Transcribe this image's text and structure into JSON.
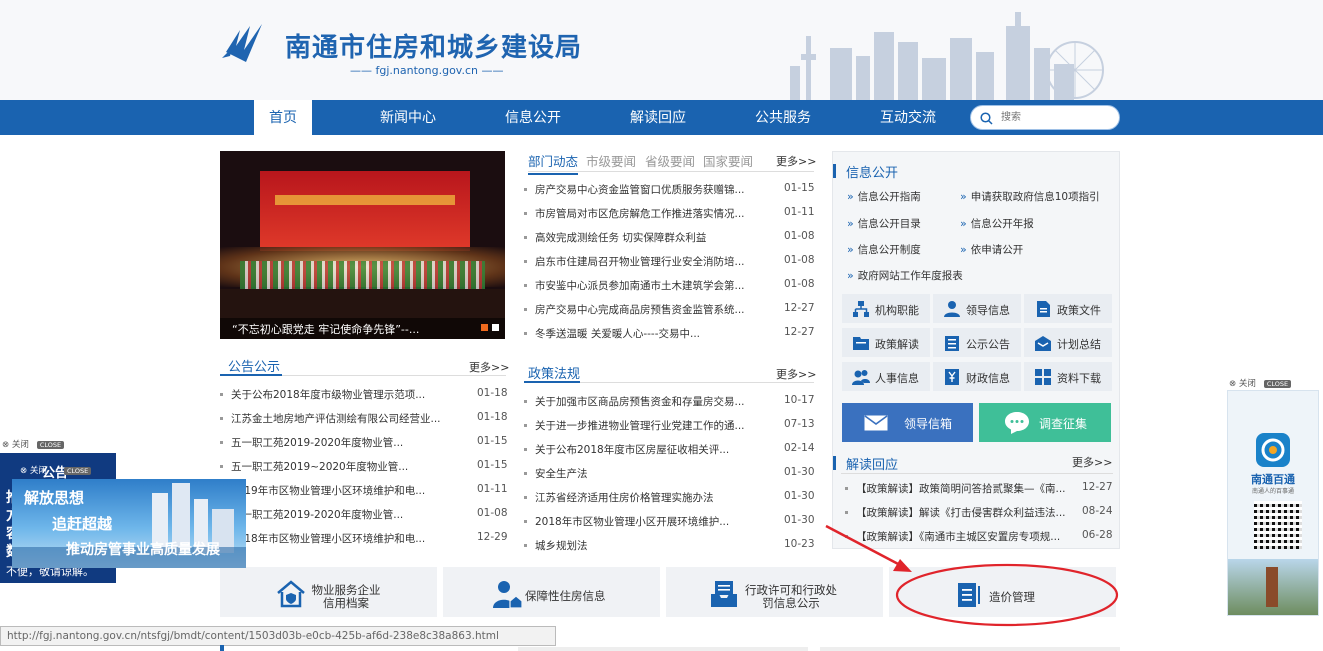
{
  "header": {
    "site_title": "南通市住房和城乡建设局",
    "domain": "—— fgj.nantong.gov.cn ——"
  },
  "nav": {
    "items": [
      "首页",
      "新闻中心",
      "信息公开",
      "解读回应",
      "公共服务",
      "互动交流"
    ],
    "active_index": 0
  },
  "search": {
    "placeholder": "搜索"
  },
  "slideshow": {
    "caption": "“不忘初心跟党走 牢记使命争先锋”--...",
    "dots": [
      {
        "color": "#f06a1e"
      },
      {
        "color": "#ffffff"
      }
    ]
  },
  "news": {
    "tabs": [
      "部门动态",
      "市级要闻",
      "省级要闻",
      "国家要闻"
    ],
    "active_tab": 0,
    "more": "更多>>",
    "items": [
      {
        "title": "房产交易中心资金监管窗口优质服务获赠锦...",
        "date": "01-15"
      },
      {
        "title": "市房管局对市区危房解危工作推进落实情况...",
        "date": "01-11"
      },
      {
        "title": "高效完成测绘任务 切实保障群众利益",
        "date": "01-08"
      },
      {
        "title": "启东市住建局召开物业管理行业安全消防培...",
        "date": "01-08"
      },
      {
        "title": "市安鉴中心派员参加南通市土木建筑学会第...",
        "date": "01-08"
      },
      {
        "title": "房产交易中心完成商品房预售资金监管系统...",
        "date": "12-27"
      },
      {
        "title": "冬季送温暖 关爱暖人心----交易中...",
        "date": "12-27"
      }
    ]
  },
  "notice": {
    "title": "公告公示",
    "more": "更多>>",
    "items": [
      {
        "title": "关于公布2018年度市级物业管理示范项...",
        "date": "01-18"
      },
      {
        "title": "江苏金土地房地产评估测绘有限公司经营业...",
        "date": "01-18"
      },
      {
        "title": "五一职工苑2019-2020年度物业管...",
        "date": "01-15"
      },
      {
        "title": "五一职工苑2019~2020年度物业管...",
        "date": "01-15"
      },
      {
        "title": "2019年市区物业管理小区环境维护和电...",
        "date": "01-11"
      },
      {
        "title": "五一职工苑2019-2020年度物业管...",
        "date": "01-08"
      },
      {
        "title": "2018年市区物业管理小区环境维护和电...",
        "date": "12-29"
      }
    ]
  },
  "policy": {
    "title": "政策法规",
    "more": "更多>>",
    "items": [
      {
        "title": "关于加强市区商品房预售资金和存量房交易...",
        "date": "10-17"
      },
      {
        "title": "关于进一步推进物业管理行业党建工作的通...",
        "date": "07-13"
      },
      {
        "title": "关于公布2018年度市区房屋征收相关评...",
        "date": "02-14"
      },
      {
        "title": "安全生产法",
        "date": "01-30"
      },
      {
        "title": "江苏省经济适用住房价格管理实施办法",
        "date": "01-30"
      },
      {
        "title": "2018年市区物业管理小区开展环境维护...",
        "date": "01-30"
      },
      {
        "title": "城乡规划法",
        "date": "10-23"
      }
    ]
  },
  "info_open": {
    "title": "信息公开",
    "links": [
      "信息公开指南",
      "申请获取政府信息10项指引",
      "信息公开目录",
      "信息公开年报",
      "信息公开制度",
      "依申请公开",
      "政府网站工作年度报表"
    ],
    "tiles": [
      {
        "label": "机构职能",
        "icon": "org-chart-icon"
      },
      {
        "label": "领导信息",
        "icon": "leader-icon"
      },
      {
        "label": "政策文件",
        "icon": "policy-file-icon"
      },
      {
        "label": "政策解读",
        "icon": "policy-interpret-icon"
      },
      {
        "label": "公示公告",
        "icon": "notice-board-icon"
      },
      {
        "label": "计划总结",
        "icon": "plan-summary-icon"
      },
      {
        "label": "人事信息",
        "icon": "personnel-icon"
      },
      {
        "label": "财政信息",
        "icon": "finance-icon"
      },
      {
        "label": "资料下载",
        "icon": "download-grid-icon"
      }
    ],
    "mailbox": {
      "label": "领导信箱",
      "color": "#3a71bf"
    },
    "survey": {
      "label": "调查征集",
      "color": "#3fbf98"
    }
  },
  "interpretation": {
    "title": "解读回应",
    "more": "更多>>",
    "items": [
      {
        "title": "【政策解读】政策简明问答拾贰聚集—《南...",
        "date": "12-27"
      },
      {
        "title": "【政策解读】解读《打击侵害群众利益违法...",
        "date": "08-24"
      },
      {
        "title": "【政策解读】《南通市主城区安置房专项规...",
        "date": "06-28"
      }
    ]
  },
  "services": [
    {
      "line1": "物业服务企业",
      "line2": "信用档案",
      "icon": "house-shield-icon"
    },
    {
      "line1": "保障性住房信息",
      "line2": "",
      "icon": "person-house-icon"
    },
    {
      "line1": "行政许可和行政处",
      "line2": "罚信息公示",
      "icon": "inbox-doc-icon"
    },
    {
      "line1": "造价管理",
      "line2": "",
      "icon": "document-icon"
    }
  ],
  "ads": {
    "close_text": "⊗ 关闭",
    "close_label": "CLOSE",
    "left_title": "公告",
    "left_chars": [
      "推",
      "方",
      "容",
      "数",
      "不"
    ],
    "left_bottom": "不便，敬请谅解。",
    "banner_line1": "解放思想",
    "banner_line2": "追赶超越",
    "banner_line3": "推动房管事业高质量发展",
    "right_app": "南通百通",
    "right_sub": "南通人的百事通"
  },
  "statusbar": {
    "url": "http://fgj.nantong.gov.cn/ntsfgj/bmdt/content/1503d03b-e0cb-425b-af6d-238e8c38a863.html"
  },
  "colors": {
    "brand": "#1a63b0",
    "annotation": "#e0242b"
  }
}
